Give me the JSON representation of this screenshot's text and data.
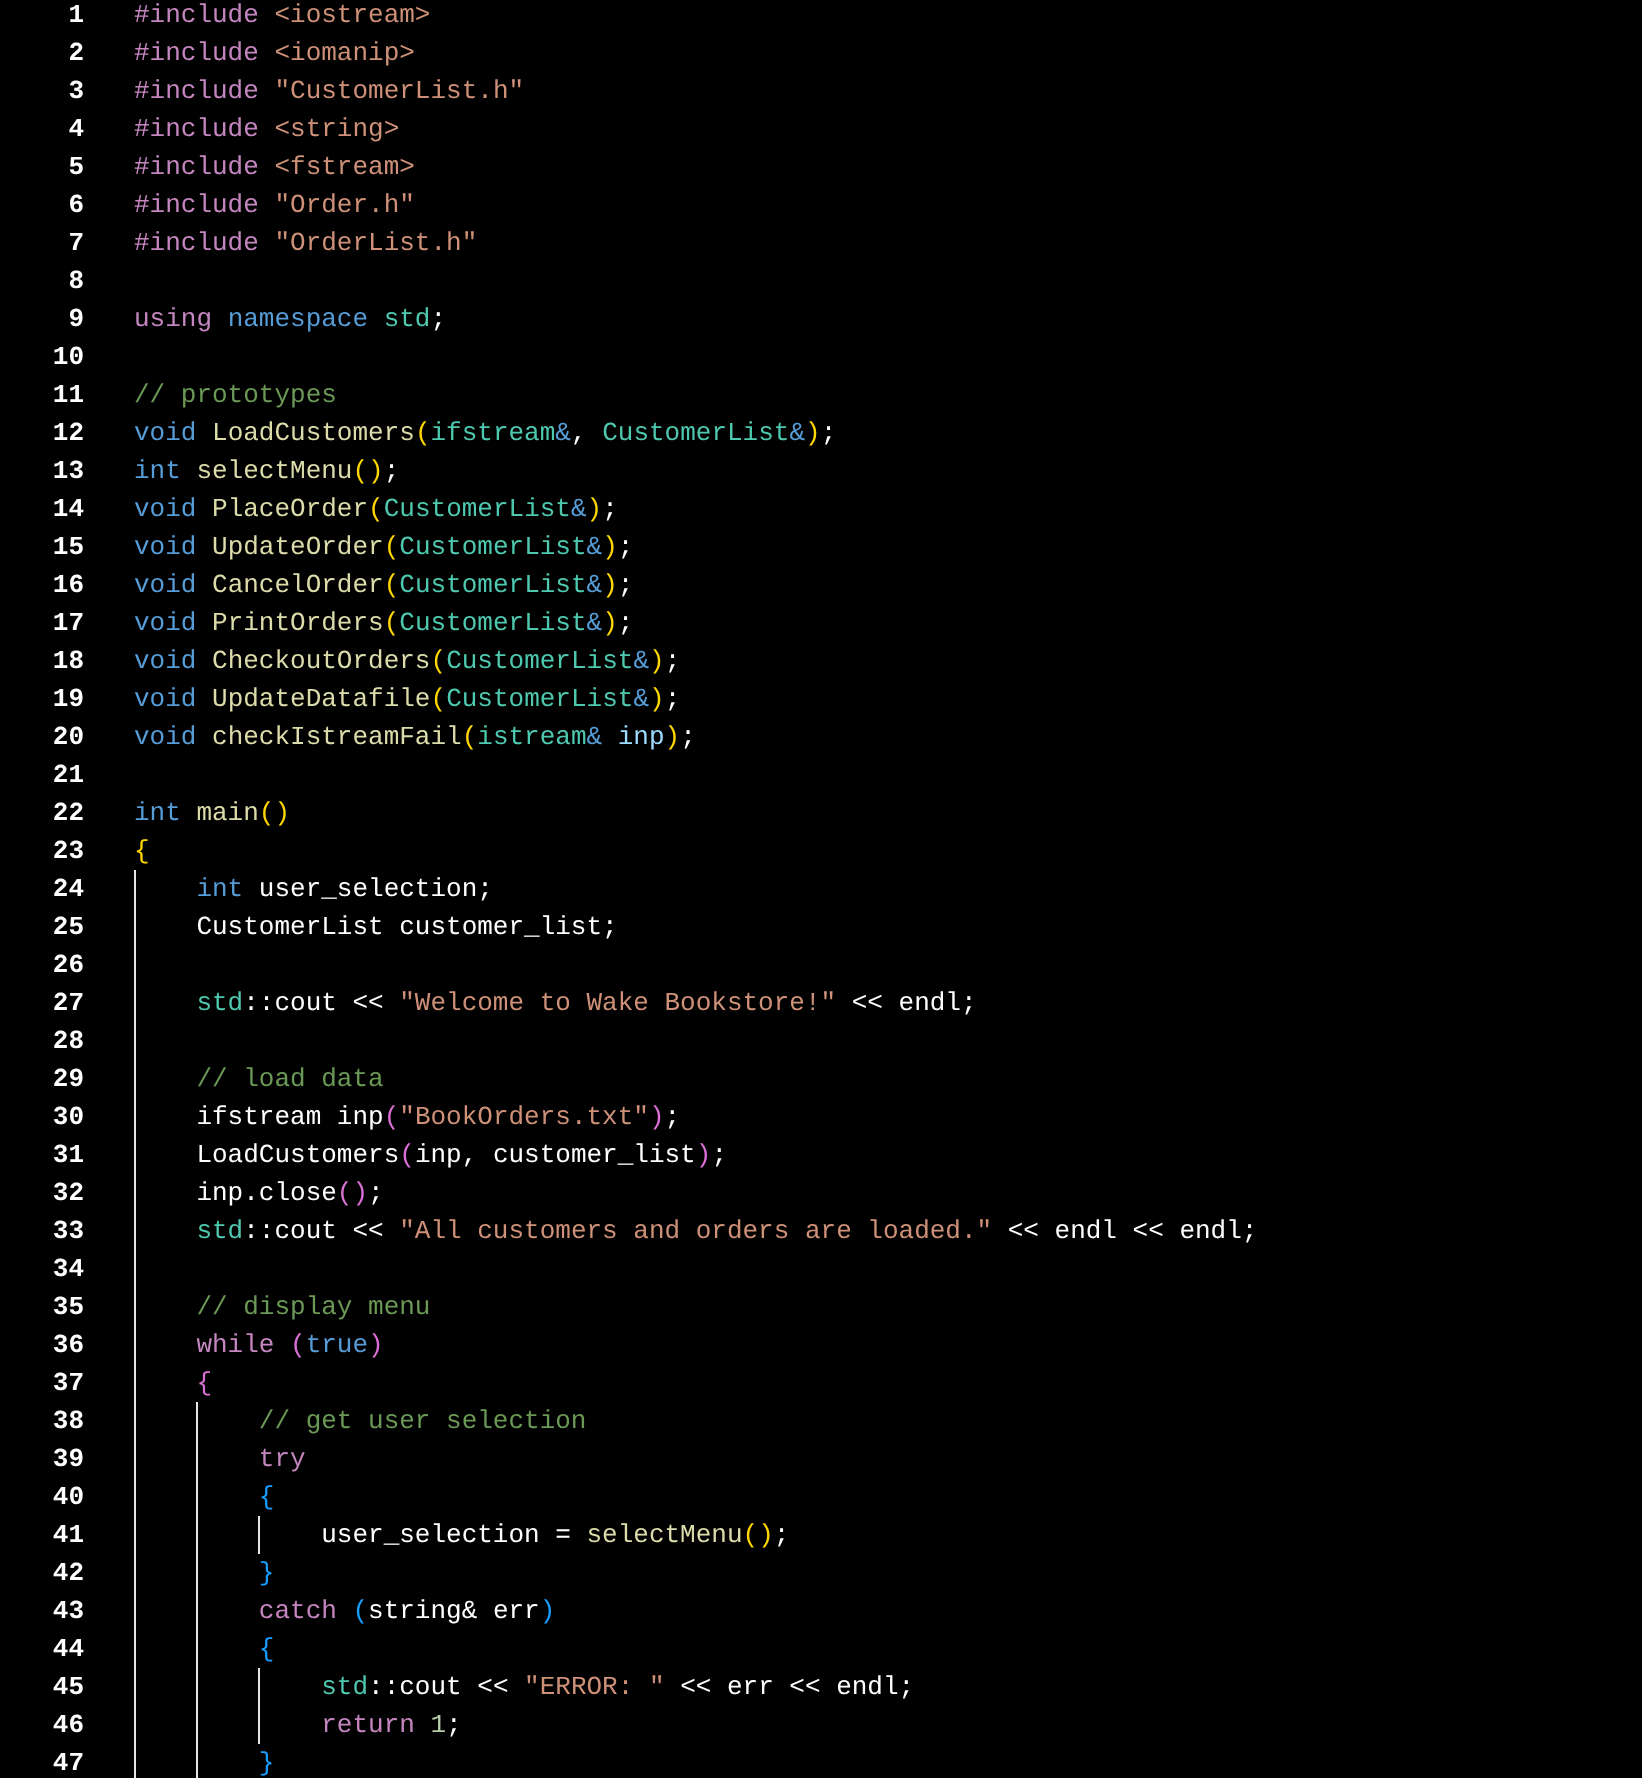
{
  "editor": {
    "lines": [
      {
        "number": "1",
        "tokens": [
          {
            "kind": "directive",
            "text": "#include"
          },
          {
            "kind": "string",
            "text": " <iostream>"
          }
        ]
      },
      {
        "number": "2",
        "tokens": [
          {
            "kind": "directive",
            "text": "#include"
          },
          {
            "kind": "string",
            "text": " <iomanip>"
          }
        ]
      },
      {
        "number": "3",
        "tokens": [
          {
            "kind": "directive",
            "text": "#include"
          },
          {
            "kind": "string",
            "text": " \"CustomerList.h\""
          }
        ]
      },
      {
        "number": "4",
        "tokens": [
          {
            "kind": "directive",
            "text": "#include"
          },
          {
            "kind": "string",
            "text": " <string>"
          }
        ]
      },
      {
        "number": "5",
        "tokens": [
          {
            "kind": "directive",
            "text": "#include"
          },
          {
            "kind": "string",
            "text": " <fstream>"
          }
        ]
      },
      {
        "number": "6",
        "tokens": [
          {
            "kind": "directive",
            "text": "#include"
          },
          {
            "kind": "string",
            "text": " \"Order.h\""
          }
        ]
      },
      {
        "number": "7",
        "tokens": [
          {
            "kind": "directive",
            "text": "#include"
          },
          {
            "kind": "string",
            "text": " \"OrderList.h\""
          }
        ]
      },
      {
        "number": "8"
      },
      {
        "number": "9",
        "tokens": [
          {
            "kind": "control",
            "text": "using"
          },
          {
            "kind": "keyword",
            "text": " namespace"
          },
          {
            "kind": "type",
            "text": " std"
          },
          {
            "kind": "plain",
            "text": ";"
          }
        ]
      },
      {
        "number": "10"
      },
      {
        "number": "11",
        "tokens": [
          {
            "kind": "comment",
            "text": "// prototypes"
          }
        ]
      },
      {
        "number": "12",
        "tokens": [
          {
            "kind": "keyword",
            "text": "void"
          },
          {
            "kind": "function",
            "text": " LoadCustomers"
          },
          {
            "kind": "open",
            "text": "("
          },
          {
            "kind": "type",
            "text": "ifstream"
          },
          {
            "kind": "keyword",
            "text": "&"
          },
          {
            "kind": "plain",
            "text": ","
          },
          {
            "kind": "type",
            "text": " CustomerList"
          },
          {
            "kind": "keyword",
            "text": "&"
          },
          {
            "kind": "close",
            "text": ")"
          },
          {
            "kind": "plain",
            "text": ";"
          }
        ]
      },
      {
        "number": "13",
        "tokens": [
          {
            "kind": "keyword",
            "text": "int"
          },
          {
            "kind": "function",
            "text": " selectMenu"
          },
          {
            "kind": "open",
            "text": "("
          },
          {
            "kind": "close",
            "text": ")"
          },
          {
            "kind": "plain",
            "text": ";"
          }
        ]
      },
      {
        "number": "14",
        "tokens": [
          {
            "kind": "keyword",
            "text": "void"
          },
          {
            "kind": "function",
            "text": " PlaceOrder"
          },
          {
            "kind": "open",
            "text": "("
          },
          {
            "kind": "type",
            "text": "CustomerList"
          },
          {
            "kind": "keyword",
            "text": "&"
          },
          {
            "kind": "close",
            "text": ")"
          },
          {
            "kind": "plain",
            "text": ";"
          }
        ]
      },
      {
        "number": "15",
        "tokens": [
          {
            "kind": "keyword",
            "text": "void"
          },
          {
            "kind": "function",
            "text": " UpdateOrder"
          },
          {
            "kind": "open",
            "text": "("
          },
          {
            "kind": "type",
            "text": "CustomerList"
          },
          {
            "kind": "keyword",
            "text": "&"
          },
          {
            "kind": "close",
            "text": ")"
          },
          {
            "kind": "plain",
            "text": ";"
          }
        ]
      },
      {
        "number": "16",
        "tokens": [
          {
            "kind": "keyword",
            "text": "void"
          },
          {
            "kind": "function",
            "text": " CancelOrder"
          },
          {
            "kind": "open",
            "text": "("
          },
          {
            "kind": "type",
            "text": "CustomerList"
          },
          {
            "kind": "keyword",
            "text": "&"
          },
          {
            "kind": "close",
            "text": ")"
          },
          {
            "kind": "plain",
            "text": ";"
          }
        ]
      },
      {
        "number": "17",
        "tokens": [
          {
            "kind": "keyword",
            "text": "void"
          },
          {
            "kind": "function",
            "text": " PrintOrders"
          },
          {
            "kind": "open",
            "text": "("
          },
          {
            "kind": "type",
            "text": "CustomerList"
          },
          {
            "kind": "keyword",
            "text": "&"
          },
          {
            "kind": "close",
            "text": ")"
          },
          {
            "kind": "plain",
            "text": ";"
          }
        ]
      },
      {
        "number": "18",
        "tokens": [
          {
            "kind": "keyword",
            "text": "void"
          },
          {
            "kind": "function",
            "text": " CheckoutOrders"
          },
          {
            "kind": "open",
            "text": "("
          },
          {
            "kind": "type",
            "text": "CustomerList"
          },
          {
            "kind": "keyword",
            "text": "&"
          },
          {
            "kind": "close",
            "text": ")"
          },
          {
            "kind": "plain",
            "text": ";"
          }
        ]
      },
      {
        "number": "19",
        "tokens": [
          {
            "kind": "keyword",
            "text": "void"
          },
          {
            "kind": "function",
            "text": " UpdateDatafile"
          },
          {
            "kind": "open",
            "text": "("
          },
          {
            "kind": "type",
            "text": "CustomerList"
          },
          {
            "kind": "keyword",
            "text": "&"
          },
          {
            "kind": "close",
            "text": ")"
          },
          {
            "kind": "plain",
            "text": ";"
          }
        ]
      },
      {
        "number": "20",
        "tokens": [
          {
            "kind": "keyword",
            "text": "void"
          },
          {
            "kind": "function",
            "text": " checkIstreamFail"
          },
          {
            "kind": "open",
            "text": "("
          },
          {
            "kind": "type",
            "text": "istream"
          },
          {
            "kind": "keyword",
            "text": "&"
          },
          {
            "kind": "variable",
            "text": " inp"
          },
          {
            "kind": "close",
            "text": ")"
          },
          {
            "kind": "plain",
            "text": ";"
          }
        ]
      },
      {
        "number": "21"
      },
      {
        "number": "22",
        "tokens": [
          {
            "kind": "keyword",
            "text": "int"
          },
          {
            "kind": "function",
            "text": " main"
          },
          {
            "kind": "open",
            "text": "("
          },
          {
            "kind": "close",
            "text": ")"
          }
        ]
      },
      {
        "number": "23",
        "tokens": [
          {
            "kind": "open",
            "text": "{"
          }
        ]
      },
      {
        "number": "24",
        "tokens": [
          {
            "kind": "keyword",
            "text": "    int"
          },
          {
            "kind": "plain",
            "text": " user_selection;"
          }
        ]
      },
      {
        "number": "25",
        "tokens": [
          {
            "kind": "plain",
            "text": "    CustomerList customer_list;"
          }
        ]
      },
      {
        "number": "26"
      },
      {
        "number": "27",
        "tokens": [
          {
            "kind": "type",
            "text": "    std"
          },
          {
            "kind": "plain",
            "text": "::cout <<"
          },
          {
            "kind": "string",
            "text": " \"Welcome to Wake Bookstore!\""
          },
          {
            "kind": "plain",
            "text": " << endl;"
          }
        ]
      },
      {
        "number": "28"
      },
      {
        "number": "29",
        "tokens": [
          {
            "kind": "comment",
            "text": "    // load data"
          }
        ]
      },
      {
        "number": "30",
        "tokens": [
          {
            "kind": "plain",
            "text": "    ifstream inp"
          },
          {
            "kind": "open",
            "text": "("
          },
          {
            "kind": "string",
            "text": "\"BookOrders.txt\""
          },
          {
            "kind": "close",
            "text": ")"
          },
          {
            "kind": "plain",
            "text": ";"
          }
        ]
      },
      {
        "number": "31",
        "tokens": [
          {
            "kind": "plain",
            "text": "    LoadCustomers"
          },
          {
            "kind": "open",
            "text": "("
          },
          {
            "kind": "plain",
            "text": "inp, customer_list"
          },
          {
            "kind": "close",
            "text": ")"
          },
          {
            "kind": "plain",
            "text": ";"
          }
        ]
      },
      {
        "number": "32",
        "tokens": [
          {
            "kind": "plain",
            "text": "    inp.close"
          },
          {
            "kind": "open",
            "text": "("
          },
          {
            "kind": "close",
            "text": ")"
          },
          {
            "kind": "plain",
            "text": ";"
          }
        ]
      },
      {
        "number": "33",
        "tokens": [
          {
            "kind": "type",
            "text": "    std"
          },
          {
            "kind": "plain",
            "text": "::cout <<"
          },
          {
            "kind": "string",
            "text": " \"All customers and orders are loaded.\""
          },
          {
            "kind": "plain",
            "text": " << endl << endl;"
          }
        ]
      },
      {
        "number": "34"
      },
      {
        "number": "35",
        "tokens": [
          {
            "kind": "comment",
            "text": "    // display menu"
          }
        ]
      },
      {
        "number": "36",
        "tokens": [
          {
            "kind": "control",
            "text": "    while"
          },
          {
            "kind": "open",
            "text": " ("
          },
          {
            "kind": "keyword",
            "text": "true"
          },
          {
            "kind": "close",
            "text": ")"
          }
        ]
      },
      {
        "number": "37",
        "tokens": [
          {
            "kind": "open",
            "text": "    {"
          }
        ]
      },
      {
        "number": "38",
        "tokens": [
          {
            "kind": "comment",
            "text": "        // get user selection"
          }
        ]
      },
      {
        "number": "39",
        "tokens": [
          {
            "kind": "control",
            "text": "        try"
          }
        ]
      },
      {
        "number": "40",
        "tokens": [
          {
            "kind": "open",
            "text": "        {"
          }
        ]
      },
      {
        "number": "41",
        "tokens": [
          {
            "kind": "plain",
            "text": "            user_selection ="
          },
          {
            "kind": "function",
            "text": " selectMenu"
          },
          {
            "kind": "open",
            "text": "("
          },
          {
            "kind": "close",
            "text": ")"
          },
          {
            "kind": "plain",
            "text": ";"
          }
        ]
      },
      {
        "number": "42",
        "tokens": [
          {
            "kind": "close",
            "text": "        }"
          }
        ]
      },
      {
        "number": "43",
        "tokens": [
          {
            "kind": "control",
            "text": "        catch"
          },
          {
            "kind": "open",
            "text": " ("
          },
          {
            "kind": "plain",
            "text": "string& err"
          },
          {
            "kind": "close",
            "text": ")"
          }
        ]
      },
      {
        "number": "44",
        "tokens": [
          {
            "kind": "open",
            "text": "        {"
          }
        ]
      },
      {
        "number": "45",
        "tokens": [
          {
            "kind": "type",
            "text": "            std"
          },
          {
            "kind": "plain",
            "text": "::cout <<"
          },
          {
            "kind": "string",
            "text": " \"ERROR: \""
          },
          {
            "kind": "plain",
            "text": " << err << endl;"
          }
        ]
      },
      {
        "number": "46",
        "tokens": [
          {
            "kind": "control",
            "text": "            return"
          },
          {
            "kind": "number",
            "text": " 1"
          },
          {
            "kind": "plain",
            "text": ";"
          }
        ]
      },
      {
        "number": "47",
        "tokens": [
          {
            "kind": "close",
            "text": "        }"
          }
        ]
      }
    ]
  }
}
